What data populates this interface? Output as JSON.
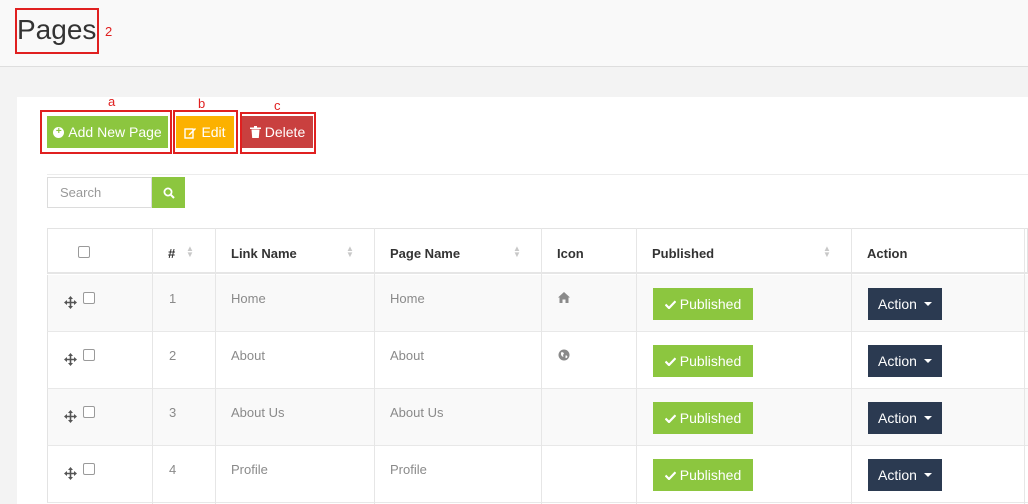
{
  "page": {
    "title": "Pages",
    "annotation": "2"
  },
  "toolbar": {
    "add_label": "Add New Page",
    "edit_label": "Edit",
    "delete_label": "Delete",
    "annotations": [
      "a",
      "b",
      "c"
    ]
  },
  "search": {
    "placeholder": "Search"
  },
  "table": {
    "headers": [
      "#",
      "Link Name",
      "Page Name",
      "Icon",
      "Published",
      "Action"
    ],
    "rows": [
      {
        "num": "1",
        "link_name": "Home",
        "page_name": "Home",
        "icon": "home-icon",
        "published": "Published",
        "action": "Action"
      },
      {
        "num": "2",
        "link_name": "About",
        "page_name": "About",
        "icon": "globe-icon",
        "published": "Published",
        "action": "Action"
      },
      {
        "num": "3",
        "link_name": "About Us",
        "page_name": "About Us",
        "icon": "",
        "published": "Published",
        "action": "Action"
      },
      {
        "num": "4",
        "link_name": "Profile",
        "page_name": "Profile",
        "icon": "",
        "published": "Published",
        "action": "Action"
      }
    ]
  },
  "colors": {
    "green": "#8cc63f",
    "yellow": "#fcb100",
    "red": "#c9403f",
    "navy": "#2b3a51",
    "annotation": "#e02020"
  }
}
